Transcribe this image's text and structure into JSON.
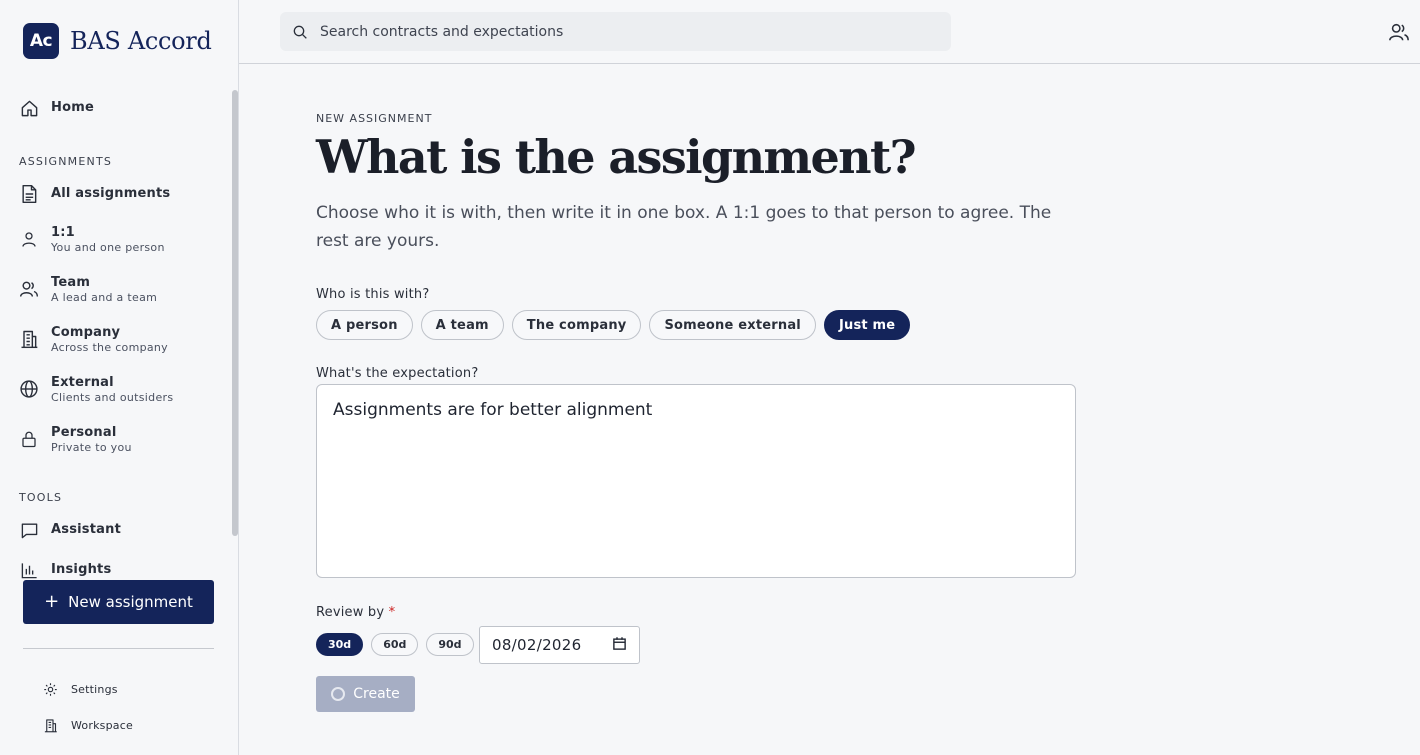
{
  "brand": {
    "logo": "Ac",
    "name": "BAS Accord"
  },
  "sidebar": {
    "home": "Home",
    "section_assignments": "ASSIGNMENTS",
    "items": [
      {
        "label": "All assignments",
        "sub": "",
        "icon": "document-icon"
      },
      {
        "label": "1:1",
        "sub": "You and one person",
        "icon": "person-icon"
      },
      {
        "label": "Team",
        "sub": "A lead and a team",
        "icon": "team-icon"
      },
      {
        "label": "Company",
        "sub": "Across the company",
        "icon": "building-icon"
      },
      {
        "label": "External",
        "sub": "Clients and outsiders",
        "icon": "globe-icon"
      },
      {
        "label": "Personal",
        "sub": "Private to you",
        "icon": "lock-icon"
      }
    ],
    "section_tools": "TOOLS",
    "tools": [
      {
        "label": "Assistant",
        "icon": "chat-icon"
      },
      {
        "label": "Insights",
        "icon": "chart-icon"
      }
    ],
    "new_button": "New assignment",
    "footer": [
      {
        "label": "Settings",
        "icon": "gear-icon"
      },
      {
        "label": "Workspace",
        "icon": "building-icon"
      }
    ]
  },
  "topbar": {
    "search_placeholder": "Search contracts and expectations"
  },
  "form": {
    "eyebrow": "NEW ASSIGNMENT",
    "title": "What is the assignment?",
    "intro": "Choose who it is with, then write it in one box. A 1:1 goes to that person to agree. The rest are yours.",
    "who_label": "Who is this with?",
    "who_options": [
      "A person",
      "A team",
      "The company",
      "Someone external",
      "Just me"
    ],
    "who_selected": "Just me",
    "expectation_label": "What's the expectation?",
    "expectation_value": "Assignments are for better alignment",
    "review_label": "Review by",
    "review_required": "*",
    "review_options": [
      "30d",
      "60d",
      "90d"
    ],
    "review_selected": "30d",
    "review_date": "08/02/2026",
    "create_label": "Create"
  },
  "colors": {
    "accent": "#14245a",
    "disabled_button": "#a6aec4"
  }
}
